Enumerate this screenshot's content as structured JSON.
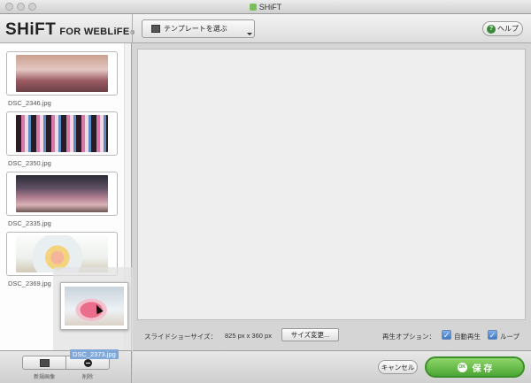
{
  "window": {
    "title": "SHiFT"
  },
  "header": {
    "logo_big": "SHiFT",
    "logo_small": "FOR WEBLiFE",
    "logo_tm": "®",
    "template_label": "テンプレートを選ぶ",
    "help_label": "ヘルプ",
    "help_icon_text": "?"
  },
  "sidebar": {
    "items": [
      {
        "filename": "DSC_2346.jpg"
      },
      {
        "filename": "DSC_2350.jpg"
      },
      {
        "filename": "DSC_2335.jpg"
      },
      {
        "filename": "DSC_2369.jpg"
      }
    ],
    "dragging": {
      "filename": "DSC_2373.jpg"
    },
    "add_label": "新規画像",
    "delete_label": "削除"
  },
  "options": {
    "slideshow_size_label": "スライドショーサイズ：",
    "slideshow_size_value": "825 px x 360 px",
    "size_change_label": "サイズ変更...",
    "playback_label": "再生オプション：",
    "autoplay_label": "自動再生",
    "autoplay_checked": true,
    "loop_label": "ループ",
    "loop_checked": true,
    "check_glyph": "✓"
  },
  "footer": {
    "cancel_label": "キャンセル",
    "save_label": "保 存",
    "ok_badge": "OK"
  }
}
